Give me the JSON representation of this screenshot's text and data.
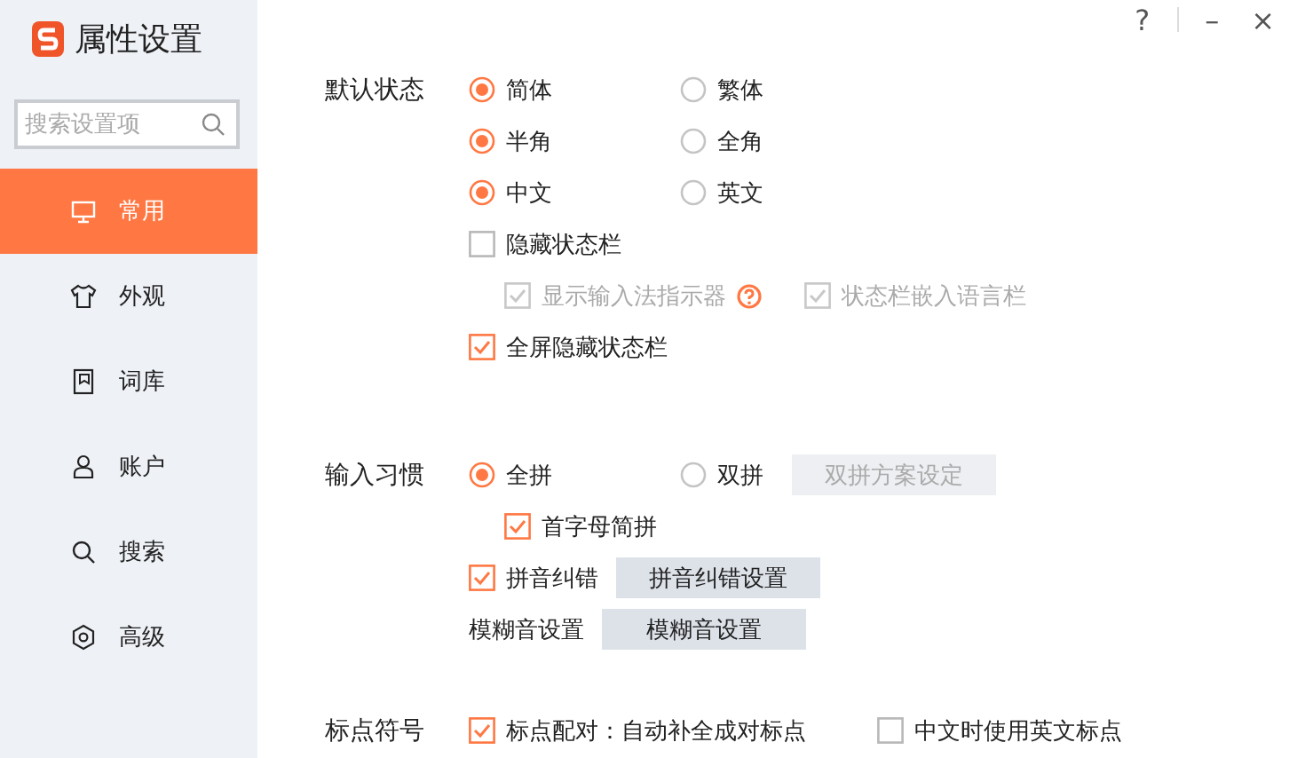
{
  "window": {
    "title": "属性设置",
    "controls": [
      "?",
      "–",
      "×"
    ]
  },
  "sidebar": {
    "search": {
      "placeholder": "搜索设置项"
    },
    "items": [
      {
        "label": "常用",
        "selected": true
      },
      {
        "label": "外观",
        "selected": false
      },
      {
        "label": "词库",
        "selected": false
      },
      {
        "label": "账户",
        "selected": false
      },
      {
        "label": "搜索",
        "selected": false
      },
      {
        "label": "高级",
        "selected": false
      }
    ]
  },
  "sections": [
    {
      "label": "默认状态",
      "rows": [
        {
          "kind": "radios",
          "options": [
            {
              "label": "简体",
              "selected": true
            },
            {
              "label": "繁体",
              "selected": false
            }
          ]
        },
        {
          "kind": "radios",
          "options": [
            {
              "label": "半角",
              "selected": true
            },
            {
              "label": "全角",
              "selected": false
            }
          ]
        },
        {
          "kind": "radios",
          "options": [
            {
              "label": "中文",
              "selected": true
            },
            {
              "label": "英文",
              "selected": false
            }
          ]
        },
        {
          "kind": "checkbox",
          "label": "隐藏状态栏",
          "checked": false,
          "disabled": false,
          "children": [
            {
              "label": "显示输入法指示器",
              "checked": true,
              "disabled": true,
              "help": true
            },
            {
              "label": "状态栏嵌入语言栏",
              "checked": true,
              "disabled": true,
              "help": false
            }
          ]
        },
        {
          "kind": "checkbox",
          "label": "全屏隐藏状态栏",
          "checked": true,
          "disabled": false
        }
      ]
    },
    {
      "label": "输入习惯",
      "rows": [
        {
          "kind": "radios",
          "options": [
            {
              "label": "全拼",
              "selected": true
            },
            {
              "label": "双拼",
              "selected": false,
              "button": {
                "label": "双拼方案设定",
                "disabled": true
              }
            }
          ],
          "children": [
            {
              "label": "首字母简拼",
              "checked": true,
              "disabled": false,
              "help": false
            }
          ]
        },
        {
          "kind": "checkbox",
          "label": "拼音纠错",
          "checked": true,
          "disabled": false,
          "button": {
            "label": "拼音纠错设置",
            "disabled": false
          }
        },
        {
          "kind": "text",
          "label": "模糊音设置",
          "button": {
            "label": "模糊音设置",
            "disabled": false
          }
        }
      ]
    },
    {
      "label": "标点符号",
      "rows": [
        {
          "kind": "checkbox",
          "label": "标点配对：自动补全成对标点",
          "checked": true,
          "disabled": false,
          "sibling": {
            "label": "中文时使用英文标点",
            "checked": false,
            "disabled": false
          }
        }
      ]
    }
  ]
}
